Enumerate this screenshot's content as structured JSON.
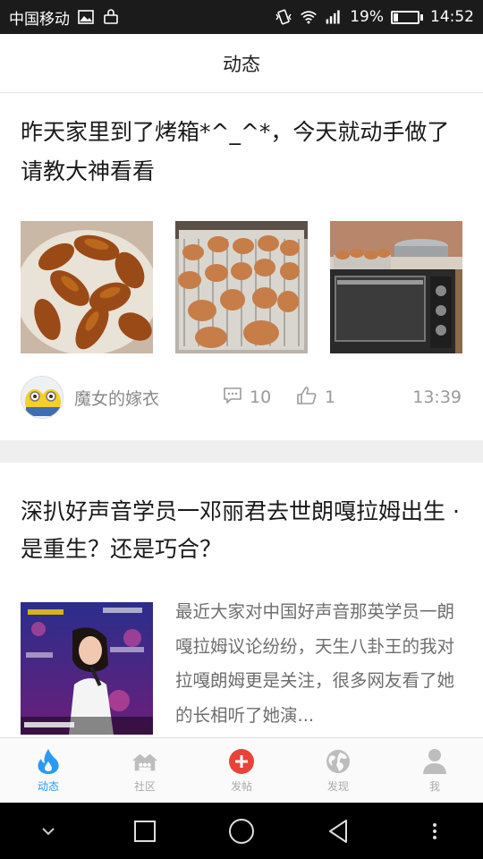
{
  "status_bar": {
    "carrier": "中国移动",
    "battery_text": "19%",
    "battery_level": 0.19,
    "time": "14:52"
  },
  "header": {
    "title": "动态"
  },
  "posts": [
    {
      "title": "昨天家里到了烤箱*^_^*，今天就动手做了请教大神看看",
      "images": [
        "roasted-chicken-wings-photo",
        "wings-on-rack-photo",
        "oven-photo"
      ],
      "author": "魔女的嫁衣",
      "comments": "10",
      "likes": "1",
      "time": "13:39"
    },
    {
      "title": "深扒好声音学员一邓丽君去世朗嘎拉姆出生 · 是重生？还是巧合？",
      "excerpt": "最近大家对中国好声音那英学员一朗嘎拉姆议论纷纷，天生八卦王的我对拉嘎朗姆更是关注，很多网友看了她的长相听了她演...",
      "thumb": "singer-video-thumbnail"
    }
  ],
  "tabs": [
    {
      "label": "动态",
      "icon": "flame-icon",
      "active": true
    },
    {
      "label": "社区",
      "icon": "community-icon",
      "active": false
    },
    {
      "label": "发帖",
      "icon": "add-post-icon",
      "active": false
    },
    {
      "label": "发现",
      "icon": "globe-icon",
      "active": false
    },
    {
      "label": "我",
      "icon": "person-icon",
      "active": false
    }
  ],
  "colors": {
    "accent_blue": "#2b9af3",
    "post_button_red": "#e8433a",
    "tab_gray": "#aaaaaa"
  }
}
